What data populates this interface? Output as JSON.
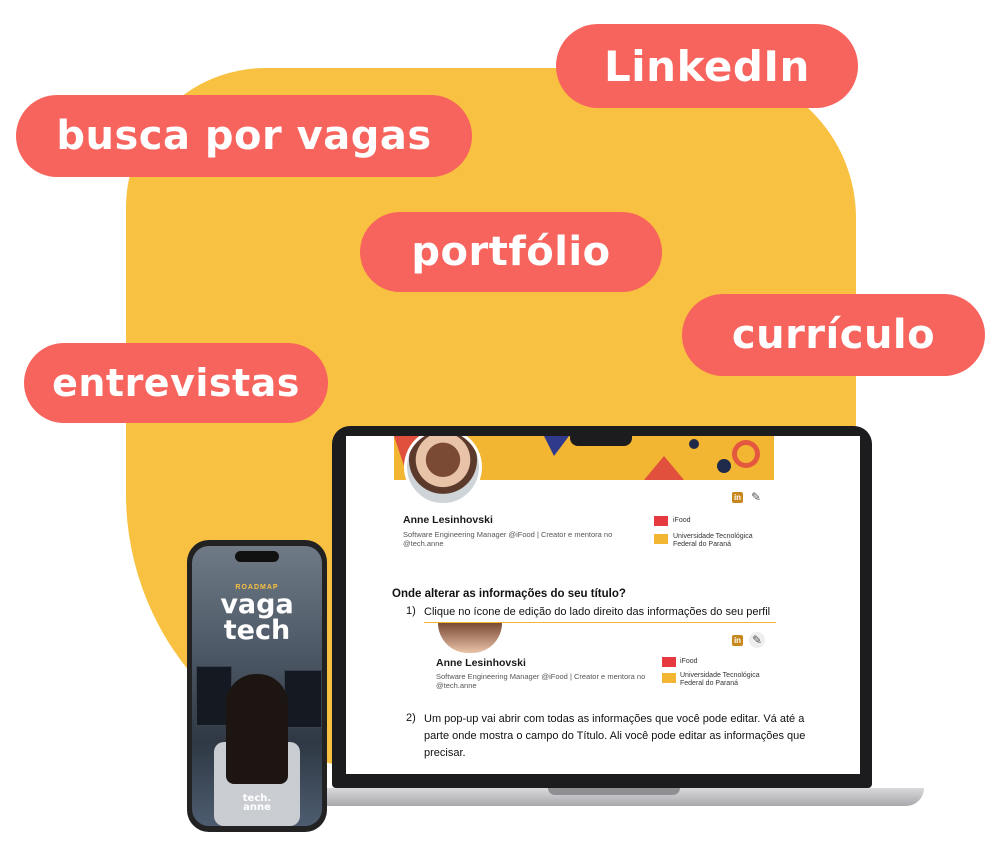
{
  "tags": {
    "linkedin": "LinkedIn",
    "busca": "busca por vagas",
    "portfolio": "portfólio",
    "curriculo": "currículo",
    "entrevistas": "entrevistas"
  },
  "profile": {
    "name": "Anne Lesinhovski",
    "headline": "Software Engineering Manager @iFood | Creator e mentora no @tech.anne",
    "org1": "iFood",
    "org2": "Universidade Tecnológica Federal do Paraná",
    "linkedin_icon": "in"
  },
  "tutorial": {
    "heading": "Onde alterar as informações do seu título?",
    "step1_num": "1)",
    "step1": "Clique no ícone de edição do lado direito das informações do seu perfil",
    "step2_num": "2)",
    "step2": "Um pop-up vai abrir com todas as informações que você pode editar. Vá até a parte onde mostra o campo do Título. Ali você pode editar as informações que precisar."
  },
  "phone": {
    "roadmap": "ROADMAP",
    "line1": "vaga",
    "line2": "tech",
    "logo1": "tech.",
    "logo2": "anne"
  },
  "colors": {
    "accent": "#f7635d",
    "blob": "#f8c141",
    "linkedin_icon": "#c8871c"
  }
}
